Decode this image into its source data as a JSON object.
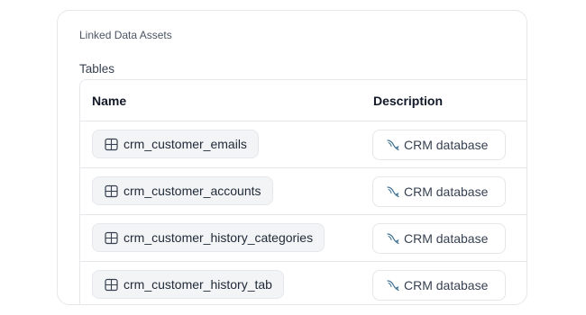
{
  "card": {
    "title": "Linked Data Assets",
    "section_label": "Tables"
  },
  "table": {
    "columns": {
      "name": "Name",
      "description": "Description"
    },
    "rows": [
      {
        "name": "crm_customer_emails",
        "description": "CRM database",
        "name_icon": "table-grid-icon",
        "desc_icon": "mysql-dolphin-icon"
      },
      {
        "name": "crm_customer_accounts",
        "description": "CRM database",
        "name_icon": "table-grid-icon",
        "desc_icon": "mysql-dolphin-icon"
      },
      {
        "name": "crm_customer_history_categories",
        "description": "CRM database",
        "name_icon": "table-grid-icon",
        "desc_icon": "mysql-dolphin-icon"
      },
      {
        "name": "crm_customer_history_tab",
        "description": "CRM database",
        "name_icon": "table-grid-icon",
        "desc_icon": "mysql-dolphin-icon"
      }
    ]
  },
  "colors": {
    "border": "#e5e7eb",
    "chip_bg": "#f3f4f6",
    "dolphin_icon": "#3b6e8f"
  }
}
